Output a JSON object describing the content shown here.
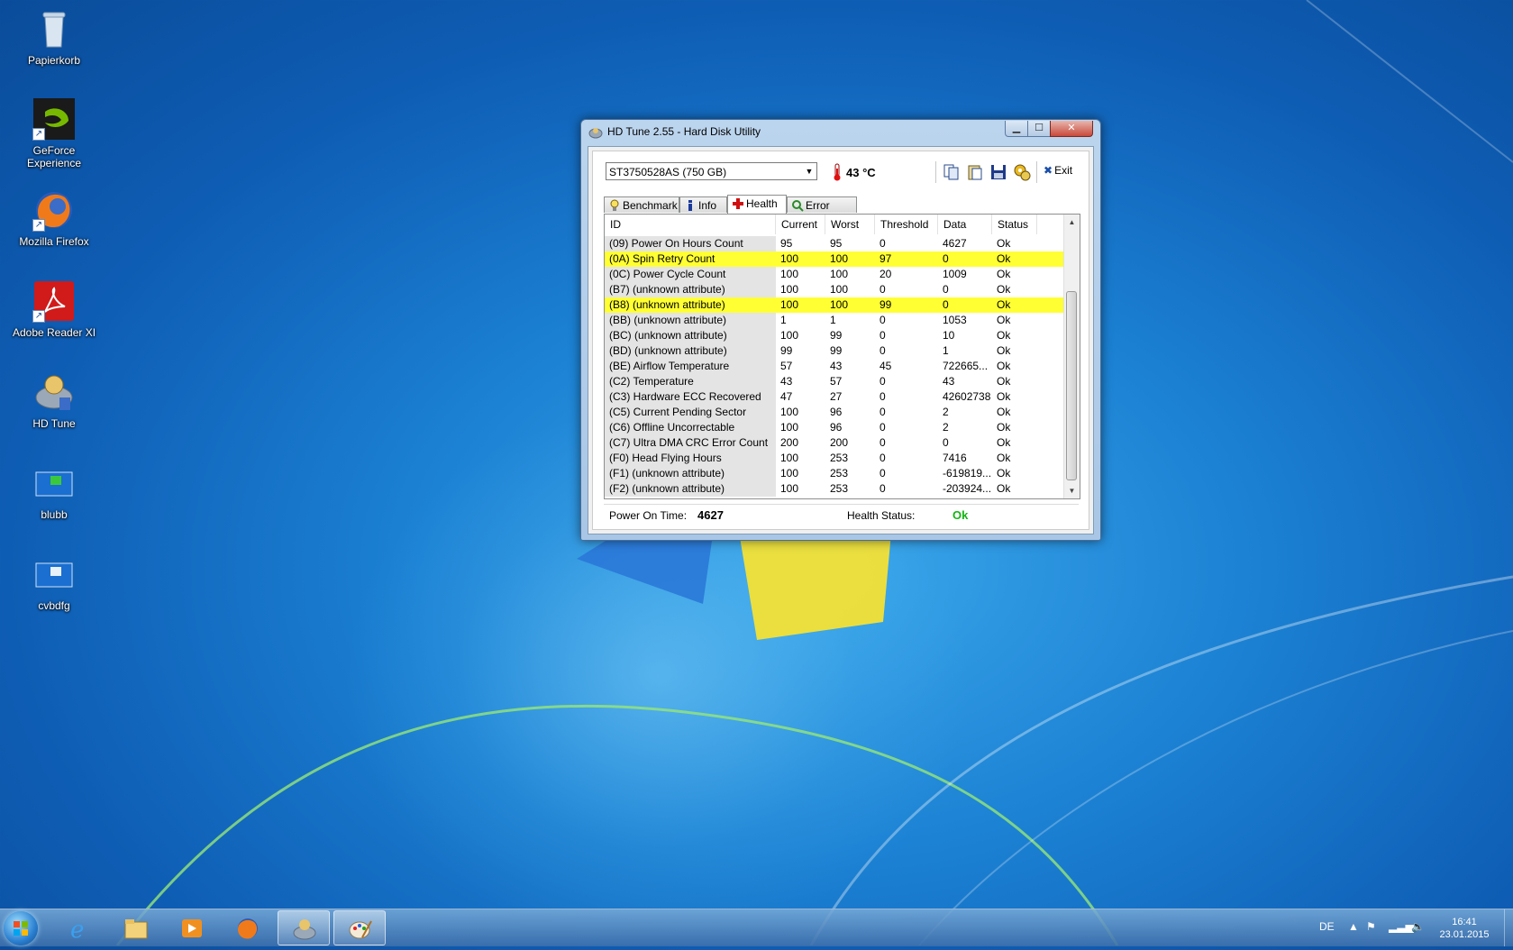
{
  "desktop": {
    "icons": [
      {
        "label": "Papierkorb",
        "icon": "recycle-bin-icon"
      },
      {
        "label": "GeForce Experience",
        "icon": "nvidia-icon"
      },
      {
        "label": "Mozilla Firefox",
        "icon": "firefox-icon"
      },
      {
        "label": "Adobe Reader XI",
        "icon": "pdf-icon"
      },
      {
        "label": "HD Tune",
        "icon": "hdtune-icon"
      },
      {
        "label": "blubb",
        "icon": "monitor-icon"
      },
      {
        "label": "cvbdfg",
        "icon": "monitor-icon"
      }
    ]
  },
  "window": {
    "title": "HD Tune 2.55 - Hard Disk Utility",
    "drive": "ST3750528AS (750 GB)",
    "temperature": "43 °C",
    "exit_label": "Exit",
    "tabs": [
      {
        "label": "Benchmark",
        "icon": "lightbulb-icon",
        "active": false
      },
      {
        "label": "Info",
        "icon": "info-icon",
        "active": false
      },
      {
        "label": "Health",
        "icon": "red-cross-icon",
        "active": true
      },
      {
        "label": "Error Scan",
        "icon": "magnifier-icon",
        "active": false
      }
    ],
    "columns": [
      "ID",
      "Current",
      "Worst",
      "Threshold",
      "Data",
      "Status"
    ],
    "rows": [
      {
        "id": "(09) Power On Hours Count",
        "current": "95",
        "worst": "95",
        "threshold": "0",
        "data": "4627",
        "status": "Ok",
        "highlight": false
      },
      {
        "id": "(0A) Spin Retry Count",
        "current": "100",
        "worst": "100",
        "threshold": "97",
        "data": "0",
        "status": "Ok",
        "highlight": true
      },
      {
        "id": "(0C) Power Cycle Count",
        "current": "100",
        "worst": "100",
        "threshold": "20",
        "data": "1009",
        "status": "Ok",
        "highlight": false
      },
      {
        "id": "(B7) (unknown attribute)",
        "current": "100",
        "worst": "100",
        "threshold": "0",
        "data": "0",
        "status": "Ok",
        "highlight": false
      },
      {
        "id": "(B8) (unknown attribute)",
        "current": "100",
        "worst": "100",
        "threshold": "99",
        "data": "0",
        "status": "Ok",
        "highlight": true
      },
      {
        "id": "(BB) (unknown attribute)",
        "current": "1",
        "worst": "1",
        "threshold": "0",
        "data": "1053",
        "status": "Ok",
        "highlight": false
      },
      {
        "id": "(BC) (unknown attribute)",
        "current": "100",
        "worst": "99",
        "threshold": "0",
        "data": "10",
        "status": "Ok",
        "highlight": false
      },
      {
        "id": "(BD) (unknown attribute)",
        "current": "99",
        "worst": "99",
        "threshold": "0",
        "data": "1",
        "status": "Ok",
        "highlight": false
      },
      {
        "id": "(BE) Airflow Temperature",
        "current": "57",
        "worst": "43",
        "threshold": "45",
        "data": "722665...",
        "status": "Ok",
        "highlight": false
      },
      {
        "id": "(C2) Temperature",
        "current": "43",
        "worst": "57",
        "threshold": "0",
        "data": "43",
        "status": "Ok",
        "highlight": false
      },
      {
        "id": "(C3) Hardware ECC Recovered",
        "current": "47",
        "worst": "27",
        "threshold": "0",
        "data": "42602738",
        "status": "Ok",
        "highlight": false
      },
      {
        "id": "(C5) Current Pending Sector",
        "current": "100",
        "worst": "96",
        "threshold": "0",
        "data": "2",
        "status": "Ok",
        "highlight": false
      },
      {
        "id": "(C6) Offline Uncorrectable",
        "current": "100",
        "worst": "96",
        "threshold": "0",
        "data": "2",
        "status": "Ok",
        "highlight": false
      },
      {
        "id": "(C7) Ultra DMA CRC Error Count",
        "current": "200",
        "worst": "200",
        "threshold": "0",
        "data": "0",
        "status": "Ok",
        "highlight": false
      },
      {
        "id": "(F0) Head Flying Hours",
        "current": "100",
        "worst": "253",
        "threshold": "0",
        "data": "7416",
        "status": "Ok",
        "highlight": false
      },
      {
        "id": "(F1) (unknown attribute)",
        "current": "100",
        "worst": "253",
        "threshold": "0",
        "data": "-619819...",
        "status": "Ok",
        "highlight": false
      },
      {
        "id": "(F2) (unknown attribute)",
        "current": "100",
        "worst": "253",
        "threshold": "0",
        "data": "-203924...",
        "status": "Ok",
        "highlight": false
      }
    ],
    "power_on_time_label": "Power On Time:",
    "power_on_time_value": "4627",
    "health_status_label": "Health Status:",
    "health_status_value": "Ok"
  },
  "taskbar": {
    "apps": [
      "ie-icon",
      "explorer-icon",
      "media-player-icon",
      "firefox-icon",
      "hdtune-icon",
      "paint-icon"
    ],
    "language": "DE",
    "time": "16:41",
    "date": "23.01.2015"
  },
  "colors": {
    "highlight_row": "#ffff33",
    "ok_status": "#13b513"
  }
}
